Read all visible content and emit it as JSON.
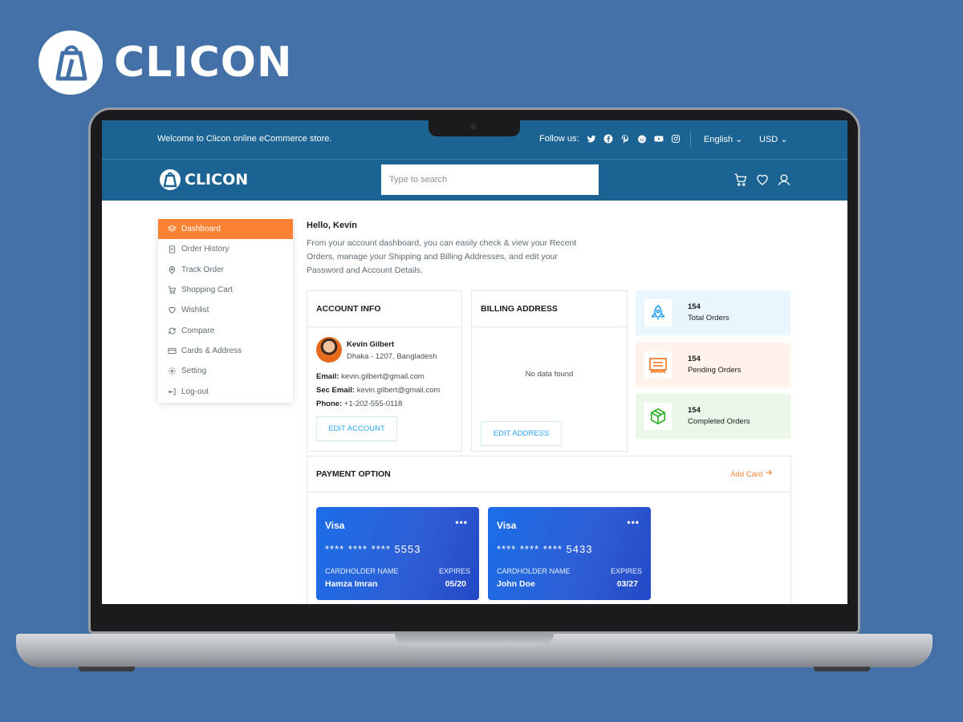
{
  "brand": {
    "name": "CLICON"
  },
  "topbar": {
    "welcome": "Welcome to Clicon online eCommerce store.",
    "follow_label": "Follow us:",
    "social_icons": [
      "twitter-icon",
      "facebook-icon",
      "pinterest-icon",
      "reddit-icon",
      "youtube-icon",
      "instagram-icon"
    ],
    "language": "English",
    "currency": "USD"
  },
  "header": {
    "logo_text": "CLICON",
    "search_placeholder": "Type to search",
    "icons": [
      "cart-icon",
      "heart-icon",
      "user-icon"
    ]
  },
  "sidebar": {
    "items": [
      {
        "label": "Dashboard",
        "icon": "layers-icon",
        "active": true
      },
      {
        "label": "Order History",
        "icon": "clipboard-icon"
      },
      {
        "label": "Track Order",
        "icon": "map-pin-icon"
      },
      {
        "label": "Shopping Cart",
        "icon": "cart-icon"
      },
      {
        "label": "Wishlist",
        "icon": "heart-icon"
      },
      {
        "label": "Compare",
        "icon": "refresh-icon"
      },
      {
        "label": "Cards & Address",
        "icon": "credit-card-icon"
      },
      {
        "label": "Setting",
        "icon": "gear-icon"
      },
      {
        "label": "Log-out",
        "icon": "logout-icon"
      }
    ]
  },
  "main": {
    "greeting": "Hello, Kevin",
    "intro": "From your account dashboard, you can easily check & view your Recent Orders, manage your Shipping and Billing Addresses, and edit your Password and Account Details."
  },
  "account_info": {
    "title": "ACCOUNT INFO",
    "name": "Kevin Gilbert",
    "location": "Dhaka - 1207, Bangladesh",
    "email_label": "Email:",
    "email": "kevin.gilbert@gmail.com",
    "sec_email_label": "Sec Email:",
    "sec_email": "kevin.gilbert@gmail.com",
    "phone_label": "Phone:",
    "phone": "+1-202-555-0118",
    "edit_label": "EDIT ACCOUNT"
  },
  "billing": {
    "title": "BILLING ADDRESS",
    "empty": "No data found",
    "edit_label": "EDIT ADDRESS"
  },
  "stats": [
    {
      "value": "154",
      "label": "Total Orders",
      "bg": "#eaf6fe",
      "icon_color": "#2da5f3",
      "icon": "rocket-icon"
    },
    {
      "value": "154",
      "label": "Pending Orders",
      "bg": "#fff3eb",
      "icon_color": "#fa8232",
      "icon": "receipt-icon"
    },
    {
      "value": "154",
      "label": "Completed Orders",
      "bg": "#eaf7e9",
      "icon_color": "#2db224",
      "icon": "package-icon"
    }
  ],
  "payment": {
    "title": "PAYMENT OPTION",
    "add_card": "Add Card",
    "cards": [
      {
        "brand": "Visa",
        "menu": "•••",
        "number": "**** **** **** 5553",
        "holder_label": "CARDHOLDER NAME",
        "holder": "Hamza Imran",
        "expires_label": "EXPIRES",
        "expires": "05/20"
      },
      {
        "brand": "Visa",
        "menu": "•••",
        "number": "**** **** **** 5433",
        "holder_label": "CARDHOLDER NAME",
        "holder": "John Doe",
        "expires_label": "EXPIRES",
        "expires": "03/27"
      }
    ]
  },
  "colors": {
    "primary": "#1b6392",
    "accent": "#fa8232",
    "link": "#2da5f3",
    "backdrop": "#4470a8"
  }
}
